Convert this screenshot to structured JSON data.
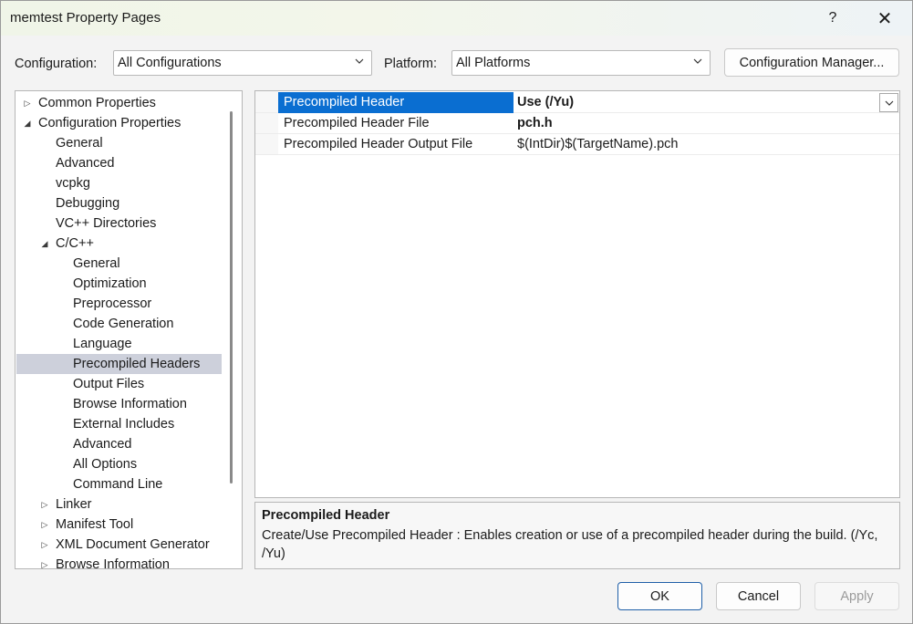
{
  "window": {
    "title": "memtest Property Pages",
    "help": "?",
    "close": "✕"
  },
  "toolbar": {
    "configuration_label": "Configuration:",
    "configuration_value": "All Configurations",
    "platform_label": "Platform:",
    "platform_value": "All Platforms",
    "config_manager": "Configuration Manager..."
  },
  "tree": {
    "items": [
      {
        "label": "Common Properties",
        "arrow": "▷"
      },
      {
        "label": "Configuration Properties",
        "arrow": "◢"
      },
      {
        "label": "General"
      },
      {
        "label": "Advanced"
      },
      {
        "label": "vcpkg"
      },
      {
        "label": "Debugging"
      },
      {
        "label": "VC++ Directories"
      },
      {
        "label": "C/C++",
        "arrow": "◢"
      },
      {
        "label": "General"
      },
      {
        "label": "Optimization"
      },
      {
        "label": "Preprocessor"
      },
      {
        "label": "Code Generation"
      },
      {
        "label": "Language"
      },
      {
        "label": "Precompiled Headers"
      },
      {
        "label": "Output Files"
      },
      {
        "label": "Browse Information"
      },
      {
        "label": "External Includes"
      },
      {
        "label": "Advanced"
      },
      {
        "label": "All Options"
      },
      {
        "label": "Command Line"
      },
      {
        "label": "Linker",
        "arrow": "▷"
      },
      {
        "label": "Manifest Tool",
        "arrow": "▷"
      },
      {
        "label": "XML Document Generator",
        "arrow": "▷"
      },
      {
        "label": "Browse Information",
        "arrow": "▷"
      }
    ]
  },
  "grid": {
    "rows": [
      {
        "name": "Precompiled Header",
        "value": "Use (/Yu)"
      },
      {
        "name": "Precompiled Header File",
        "value": "pch.h"
      },
      {
        "name": "Precompiled Header Output File",
        "value": "$(IntDir)$(TargetName).pch"
      }
    ]
  },
  "description": {
    "title": "Precompiled Header",
    "text": "Create/Use Precompiled Header : Enables creation or use of a precompiled header during the build. (/Yc, /Yu)"
  },
  "buttons": {
    "ok": "OK",
    "cancel": "Cancel",
    "apply": "Apply"
  }
}
